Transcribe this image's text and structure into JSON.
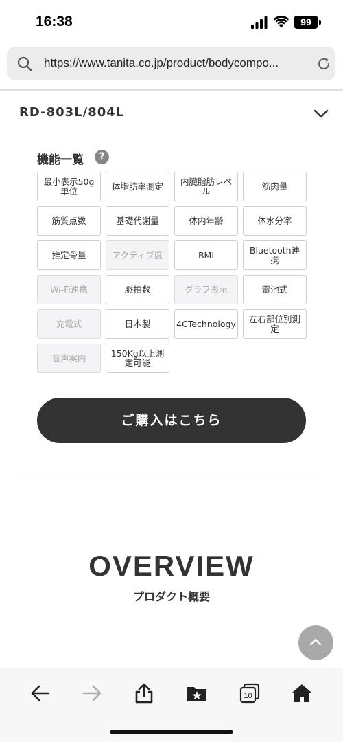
{
  "status_bar": {
    "time": "16:38",
    "battery": "99"
  },
  "address_bar": {
    "url": "https://www.tanita.co.jp/product/bodycompo..."
  },
  "product": {
    "model": "RD-803L/804L"
  },
  "features": {
    "title": "機能一覧",
    "help_glyph": "?",
    "items": [
      {
        "label": "最小表示50g単位",
        "enabled": true
      },
      {
        "label": "体脂肪率測定",
        "enabled": true
      },
      {
        "label": "内臓脂肪レベル",
        "enabled": true
      },
      {
        "label": "筋肉量",
        "enabled": true
      },
      {
        "label": "筋質点数",
        "enabled": true
      },
      {
        "label": "基礎代謝量",
        "enabled": true
      },
      {
        "label": "体内年齢",
        "enabled": true
      },
      {
        "label": "体水分率",
        "enabled": true
      },
      {
        "label": "推定骨量",
        "enabled": true
      },
      {
        "label": "アクティブ度",
        "enabled": false
      },
      {
        "label": "BMI",
        "enabled": true
      },
      {
        "label": "Bluetooth連携",
        "enabled": true
      },
      {
        "label": "Wi-Fi連携",
        "enabled": false
      },
      {
        "label": "脈拍数",
        "enabled": true
      },
      {
        "label": "グラフ表示",
        "enabled": false
      },
      {
        "label": "電池式",
        "enabled": true
      },
      {
        "label": "充電式",
        "enabled": false
      },
      {
        "label": "日本製",
        "enabled": true
      },
      {
        "label": "4CTechnology",
        "enabled": true
      },
      {
        "label": "左右部位別測定",
        "enabled": true
      },
      {
        "label": "音声案内",
        "enabled": false
      },
      {
        "label": "150Kg以上測定可能",
        "enabled": true
      }
    ]
  },
  "buy_button": {
    "label": "ご購入はこちら"
  },
  "overview": {
    "title": "OVERVIEW",
    "subtitle": "プロダクト概要"
  },
  "toolbar": {
    "tabs_count": "10"
  },
  "colors": {
    "button_bg": "#333333",
    "disabled_bg": "#f4f4f6",
    "disabled_text": "#aaaaaa"
  }
}
